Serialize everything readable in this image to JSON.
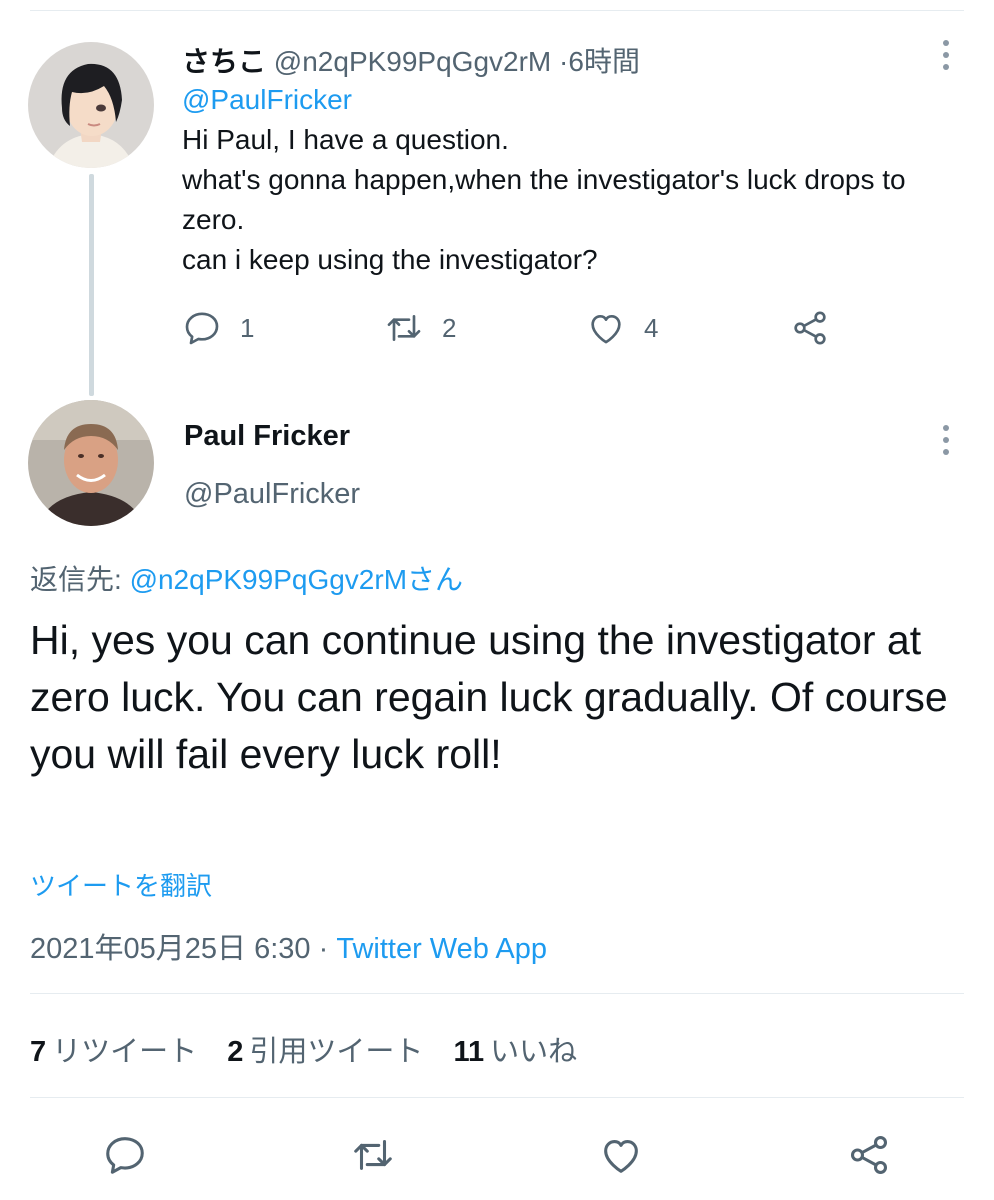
{
  "parent_tweet": {
    "display_name": "さちこ",
    "handle": "@n2qPK99PqGgv2rM",
    "separator": "·",
    "time": "6時間",
    "mention": "@PaulFricker",
    "lines": [
      "Hi Paul, I have a question.",
      "what's gonna happen,when the investigator's luck drops to zero.",
      "can i keep using the investigator?"
    ],
    "reply_count": "1",
    "retweet_count": "2",
    "like_count": "4"
  },
  "main_tweet": {
    "display_name": "Paul Fricker",
    "handle": "@PaulFricker",
    "replying_label": "返信先:",
    "replying_to": "@n2qPK99PqGgv2rMさん",
    "text": "Hi, yes you can continue using the investigator at zero luck. You can regain luck gradually. Of course you will fail every luck roll!",
    "translate_label": "ツイートを翻訳",
    "timestamp": "2021年05月25日 6:30",
    "separator": "·",
    "source": "Twitter Web App",
    "stats": {
      "retweets_count": "7",
      "retweets_label": "リツイート",
      "quotes_count": "2",
      "quotes_label": "引用ツイート",
      "likes_count": "11",
      "likes_label": "いいね"
    }
  },
  "colors": {
    "accent": "#1d9bf0",
    "text": "#0f1419",
    "secondary": "#536471",
    "divider": "#e6ecf0",
    "thread_line": "#cfd9de"
  },
  "icons": [
    "reply-icon",
    "retweet-icon",
    "like-icon",
    "share-icon",
    "more-icon"
  ]
}
